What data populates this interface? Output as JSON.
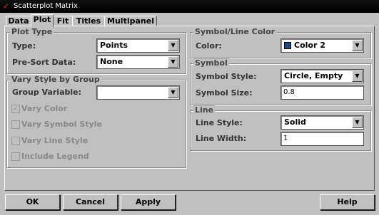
{
  "window": {
    "title": "Scatterplot Matrix"
  },
  "tabs": [
    "Data",
    "Plot",
    "Fit",
    "Titles",
    "Multipanel"
  ],
  "plot_type": {
    "title": "Plot Type",
    "type_label": "Type:",
    "type_value": "Points",
    "presort_label": "Pre-Sort Data:",
    "presort_value": "None"
  },
  "vary_style": {
    "title": "Vary Style by Group",
    "group_variable_label": "Group Variable:",
    "group_variable_value": "",
    "vary_color": "Vary Color",
    "vary_symbol_style": "Vary Symbol Style",
    "vary_line_style": "Vary Line Style",
    "include_legend": "Include Legend"
  },
  "symbol_line_color": {
    "title": "Symbol/Line Color",
    "color_label": "Color:",
    "color_value": "Color 2",
    "swatch_color": "#1a4a8a"
  },
  "symbol": {
    "title": "Symbol",
    "style_label": "Symbol Style:",
    "style_value": "Circle, Empty",
    "size_label": "Symbol Size:",
    "size_value": "0.8"
  },
  "line": {
    "title": "Line",
    "style_label": "Line Style:",
    "style_value": "Solid",
    "width_label": "Line Width:",
    "width_value": "1"
  },
  "buttons": {
    "ok": "OK",
    "cancel": "Cancel",
    "apply": "Apply",
    "help": "Help"
  }
}
